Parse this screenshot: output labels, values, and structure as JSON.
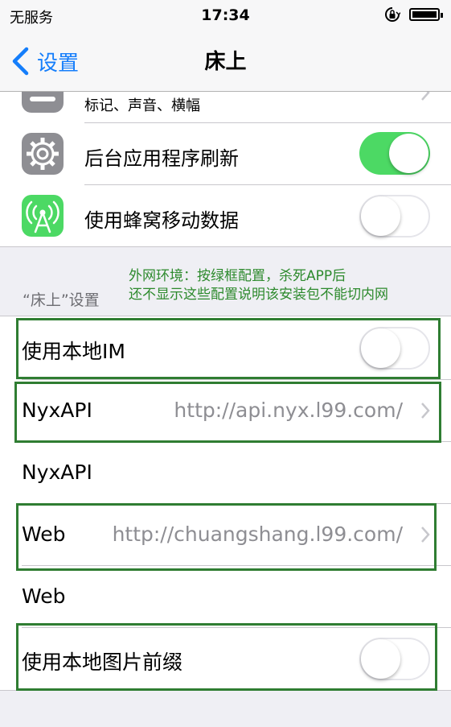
{
  "status_bar": {
    "carrier": "无服务",
    "time": "17:34"
  },
  "nav": {
    "back_label": "设置",
    "title": "床上"
  },
  "group1": {
    "partial_row_subtitle": "标记、声音、横幅",
    "background_refresh": {
      "label": "后台应用程序刷新",
      "enabled": true
    },
    "cellular_data": {
      "label": "使用蜂窝移动数据",
      "enabled": false
    }
  },
  "section": {
    "header": "“床上”设置",
    "annotation_line1": "外网环境：按绿框配置，杀死APP后",
    "annotation_line2": "还不显示这些配置说明该安装包不能切内网"
  },
  "settings": {
    "local_im": {
      "label": "使用本地IM",
      "enabled": false
    },
    "nyxapi_select": {
      "label": "NyxAPI",
      "value": "http://api.nyx.l99.com/"
    },
    "nyxapi_header": {
      "label": "NyxAPI"
    },
    "web_select": {
      "label": "Web",
      "value": "http://chuangshang.l99.com/"
    },
    "web_header": {
      "label": "Web"
    },
    "local_image_prefix": {
      "label": "使用本地图片前缀",
      "enabled": false
    }
  },
  "colors": {
    "ios_blue": "#157efb",
    "toggle_on": "#4cd964",
    "annotation_green": "#2d8a2d",
    "box_green": "#2f7d32"
  }
}
